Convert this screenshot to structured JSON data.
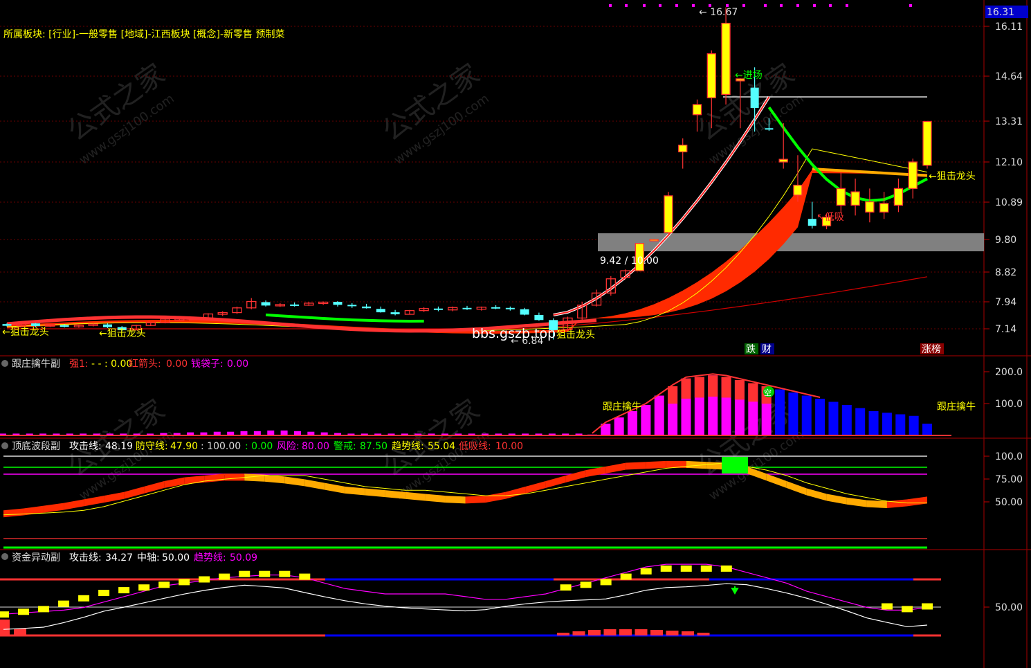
{
  "sector_info": "所属板块: [行业]-一般零售 [地域]-江西板块 [概念]-新零售 预制菜",
  "price_box": "16.31",
  "colors": {
    "up": "#ff3232",
    "down": "#54ffff",
    "yellow": "#ffff00",
    "green": "#00ff00",
    "magenta": "#ff00ff",
    "blue": "#0000ff",
    "orange": "#ffaa00",
    "gray": "#808080"
  },
  "main_annotations": {
    "high": "16.67",
    "low": "6.84",
    "entry": "←进场",
    "low_buy": "↖低吸",
    "zone": "9.42 / 10.00",
    "dragon_left": "←狙击龙头",
    "dragon_left2": "←狙击龙头",
    "dragon_mid": "狙击龙头",
    "dragon_right": "←狙击龙头",
    "badge_die": "跌",
    "badge_cai": "财",
    "badge_zhang": "涨榜",
    "bbs": "bbs.gszb.top"
  },
  "ind1": {
    "name": "跟庄擒牛副",
    "s1_label": "强1:",
    "s1_value": "- - : 0.00",
    "s2_label": "红箭头:",
    "s2_value": "0.00",
    "s3_label": "钱袋子:",
    "s3_value": "0.00",
    "tag_left": "跟庄擒牛",
    "tag_right": "跟庄擒牛",
    "tag_kong": "空"
  },
  "ind2": {
    "name": "顶底波段副",
    "attack_label": "攻击线:",
    "attack_value": "48.19",
    "defend_label": "防守线:",
    "defend_value": "47.90",
    "v100": ": 100.00",
    "v0": ": 0.00",
    "risk_label": "风险:",
    "risk_value": "80.00",
    "warn_label": "警戒:",
    "warn_value": "87.50",
    "trend_label": "趋势线:",
    "trend_value": "55.04",
    "lowbuy_label": "低吸线:",
    "lowbuy_value": "10.00"
  },
  "ind3": {
    "name": "资金异动副",
    "attack_label": "攻击线:",
    "attack_value": "34.27",
    "axis_label": "中轴:",
    "axis_value": "50.00",
    "trend_label": "趋势线:",
    "trend_value": "50.09"
  },
  "watermark": {
    "cn": "公式之家",
    "url": "www.gszj100.com"
  },
  "chart_data": [
    {
      "type": "candlestick",
      "title": "",
      "y_ticks": [
        "16.11",
        "14.64",
        "13.31",
        "12.10",
        "10.89",
        "9.80",
        "8.82",
        "7.94",
        "7.14"
      ],
      "candles": [
        [
          7.28,
          7.3,
          7.21,
          7.23
        ],
        [
          7.23,
          7.33,
          7.2,
          7.31
        ],
        [
          7.3,
          7.31,
          7.2,
          7.22
        ],
        [
          7.22,
          7.28,
          7.19,
          7.26
        ],
        [
          7.25,
          7.27,
          7.18,
          7.2
        ],
        [
          7.2,
          7.26,
          7.17,
          7.24
        ],
        [
          7.24,
          7.3,
          7.21,
          7.28
        ],
        [
          7.27,
          7.3,
          7.16,
          7.19
        ],
        [
          7.19,
          7.22,
          7.08,
          7.1
        ],
        [
          7.11,
          7.26,
          7.1,
          7.24
        ],
        [
          7.24,
          7.34,
          7.22,
          7.32
        ],
        [
          7.32,
          7.45,
          7.3,
          7.43
        ],
        [
          7.43,
          7.47,
          7.38,
          7.44
        ],
        [
          7.44,
          7.5,
          7.4,
          7.45
        ],
        [
          7.45,
          7.6,
          7.43,
          7.58
        ],
        [
          7.57,
          7.66,
          7.52,
          7.62
        ],
        [
          7.62,
          7.8,
          7.58,
          7.76
        ],
        [
          7.76,
          8.05,
          7.72,
          7.95
        ],
        [
          7.93,
          7.98,
          7.8,
          7.83
        ],
        [
          7.84,
          7.9,
          7.79,
          7.86
        ],
        [
          7.86,
          7.92,
          7.8,
          7.85
        ],
        [
          7.84,
          7.94,
          7.82,
          7.9
        ],
        [
          7.89,
          7.95,
          7.85,
          7.93
        ],
        [
          7.94,
          7.96,
          7.8,
          7.85
        ],
        [
          7.85,
          7.9,
          7.76,
          7.82
        ],
        [
          7.8,
          7.88,
          7.74,
          7.75
        ],
        [
          7.73,
          7.8,
          7.62,
          7.63
        ],
        [
          7.63,
          7.7,
          7.54,
          7.57
        ],
        [
          7.57,
          7.7,
          7.56,
          7.68
        ],
        [
          7.68,
          7.78,
          7.64,
          7.74
        ],
        [
          7.74,
          7.8,
          7.66,
          7.7
        ],
        [
          7.7,
          7.8,
          7.66,
          7.77
        ],
        [
          7.76,
          7.82,
          7.7,
          7.72
        ],
        [
          7.72,
          7.8,
          7.68,
          7.78
        ],
        [
          7.78,
          7.84,
          7.72,
          7.76
        ],
        [
          7.76,
          7.8,
          7.68,
          7.72
        ],
        [
          7.72,
          7.76,
          7.54,
          7.56
        ],
        [
          7.55,
          7.62,
          7.38,
          7.4
        ],
        [
          7.4,
          7.45,
          6.84,
          7.1
        ],
        [
          7.12,
          7.5,
          7.08,
          7.46
        ],
        [
          7.46,
          7.94,
          7.4,
          7.84
        ],
        [
          7.84,
          8.3,
          7.8,
          8.2
        ],
        [
          8.2,
          8.7,
          8.12,
          8.62
        ],
        [
          8.66,
          8.9,
          8.6,
          8.86
        ],
        [
          8.86,
          9.7,
          8.84,
          9.68
        ],
        [
          9.8,
          9.82,
          9.78,
          9.8
        ],
        [
          10.0,
          11.2,
          9.9,
          11.08
        ],
        [
          12.4,
          12.8,
          11.9,
          12.6
        ],
        [
          13.5,
          13.95,
          13.0,
          13.8
        ],
        [
          14.0,
          15.4,
          13.1,
          15.3
        ],
        [
          14.1,
          16.67,
          13.8,
          16.2
        ],
        [
          14.5,
          14.58,
          13.1,
          14.56
        ],
        [
          14.3,
          14.9,
          13.0,
          13.7
        ],
        [
          13.1,
          13.4,
          13.02,
          13.08
        ],
        [
          12.1,
          13.25,
          11.9,
          12.18
        ],
        [
          11.1,
          12.3,
          10.9,
          11.4
        ],
        [
          10.4,
          10.9,
          10.12,
          10.2
        ],
        [
          10.2,
          10.55,
          10.1,
          10.45
        ],
        [
          10.8,
          11.8,
          10.6,
          11.3
        ],
        [
          10.8,
          11.6,
          10.5,
          11.2
        ],
        [
          10.6,
          11.3,
          10.3,
          10.9
        ],
        [
          10.6,
          11.2,
          10.4,
          10.85
        ],
        [
          10.8,
          11.6,
          10.6,
          11.3
        ],
        [
          11.3,
          12.2,
          11.0,
          12.1
        ],
        [
          12.0,
          13.31,
          11.9,
          13.3
        ]
      ],
      "annotations": [
        "16.67",
        "6.84",
        "9.42",
        "10.00"
      ]
    },
    {
      "type": "bar",
      "title": "跟庄擒牛副",
      "y_ticks": [
        "200.0",
        "100.0"
      ],
      "values": [
        8,
        8,
        8,
        8,
        8,
        8,
        8,
        8,
        8,
        8,
        8,
        8,
        10,
        10,
        12,
        12,
        14,
        14,
        16,
        16,
        18,
        18,
        16,
        14,
        12,
        10,
        8,
        8,
        8,
        8,
        8,
        8,
        8,
        8,
        8,
        8,
        8,
        8,
        8,
        8,
        8,
        8,
        8,
        8,
        5,
        40,
        60,
        80,
        100,
        130,
        160,
        185,
        190,
        195,
        190,
        180,
        170,
        160,
        150,
        140,
        130,
        120,
        110,
        100,
        90,
        80,
        75,
        70,
        65,
        40
      ],
      "series_colors_note": "magenta rising, blue falling"
    },
    {
      "type": "line",
      "title": "顶底波段副",
      "y_ticks": [
        "100.0",
        "75.00",
        "50.00"
      ],
      "series": [
        {
          "name": "攻击线",
          "values": [
            40,
            42,
            45,
            48,
            52,
            56,
            60,
            66,
            72,
            76,
            78,
            80,
            80,
            79,
            77,
            74,
            70,
            66,
            64,
            62,
            60,
            58,
            56,
            55,
            56,
            60,
            66,
            72,
            78,
            84,
            88,
            92,
            93,
            94,
            94,
            93,
            92,
            88,
            80,
            72,
            64,
            58,
            54,
            51,
            50,
            52,
            55
          ]
        },
        {
          "name": "防守线",
          "values": [
            35,
            36,
            37,
            38,
            40,
            44,
            50,
            56,
            62,
            68,
            72,
            74,
            76,
            78,
            78,
            78,
            74,
            70,
            66,
            64,
            62,
            62,
            60,
            58,
            56,
            56,
            58,
            62,
            66,
            70,
            74,
            78,
            82,
            86,
            88,
            90,
            92,
            88,
            84,
            78,
            70,
            64,
            58,
            54,
            50,
            48,
            48
          ]
        }
      ]
    },
    {
      "type": "line",
      "title": "资金异动副",
      "y_ticks": [
        "50.00"
      ],
      "series": [
        {
          "name": "攻击线",
          "values": [
            44,
            46,
            48,
            52,
            56,
            60,
            62,
            64,
            66,
            68,
            70,
            72,
            74,
            74,
            74,
            72,
            70,
            68,
            66,
            64,
            62,
            60,
            58,
            56,
            56,
            58,
            60,
            62,
            64,
            66,
            68,
            72,
            76,
            78,
            78,
            78,
            78,
            76,
            72,
            68,
            64,
            60,
            56,
            52,
            50,
            48,
            50
          ]
        },
        {
          "name": "趋势线",
          "values": [
            45,
            46,
            47,
            48,
            50,
            54,
            58,
            62,
            66,
            68,
            70,
            72,
            73,
            74,
            74,
            72,
            68,
            64,
            62,
            60,
            60,
            60,
            60,
            58,
            56,
            56,
            58,
            60,
            64,
            68,
            72,
            76,
            80,
            82,
            82,
            82,
            80,
            76,
            72,
            68,
            62,
            58,
            54,
            50,
            48,
            48,
            50
          ]
        }
      ]
    }
  ]
}
